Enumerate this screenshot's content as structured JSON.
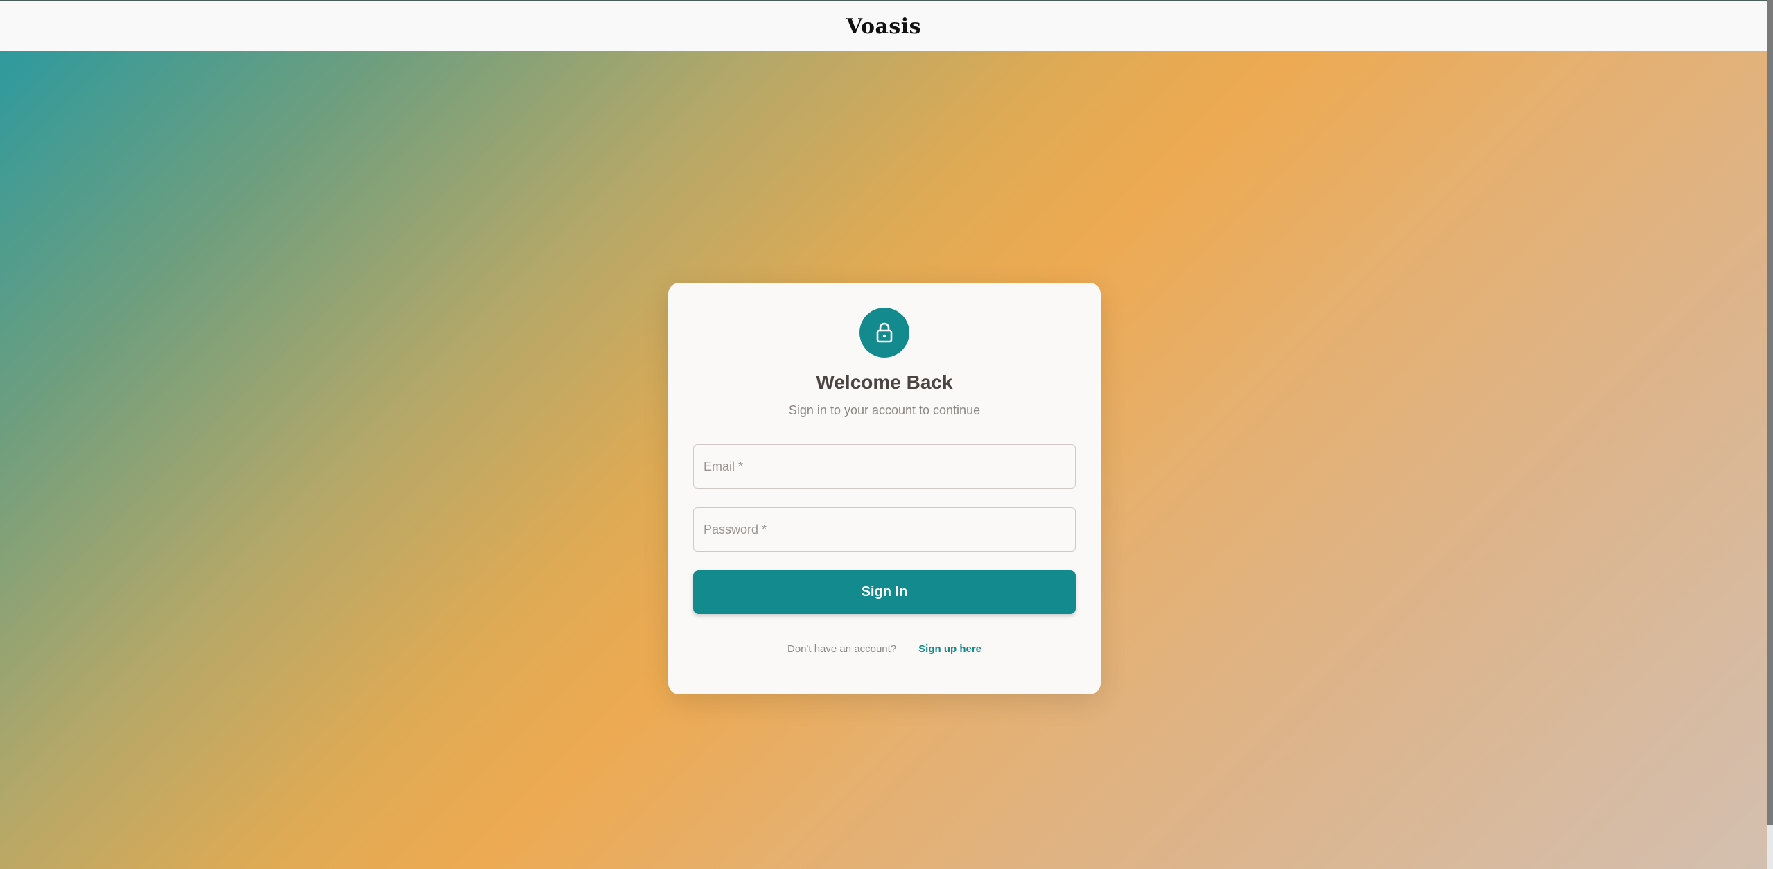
{
  "brand": "Voasis",
  "colors": {
    "primary": "#128a8e",
    "card_bg": "#fbf9f7",
    "title": "#4a4542",
    "muted": "#8c8884"
  },
  "login": {
    "icon": "lock-icon",
    "title": "Welcome Back",
    "subtitle": "Sign in to your account to continue",
    "email": {
      "placeholder": "Email *",
      "value": ""
    },
    "password": {
      "placeholder": "Password *",
      "value": ""
    },
    "submit_label": "Sign In",
    "footer_text": "Don't have an account?",
    "signup_link": "Sign up here"
  }
}
